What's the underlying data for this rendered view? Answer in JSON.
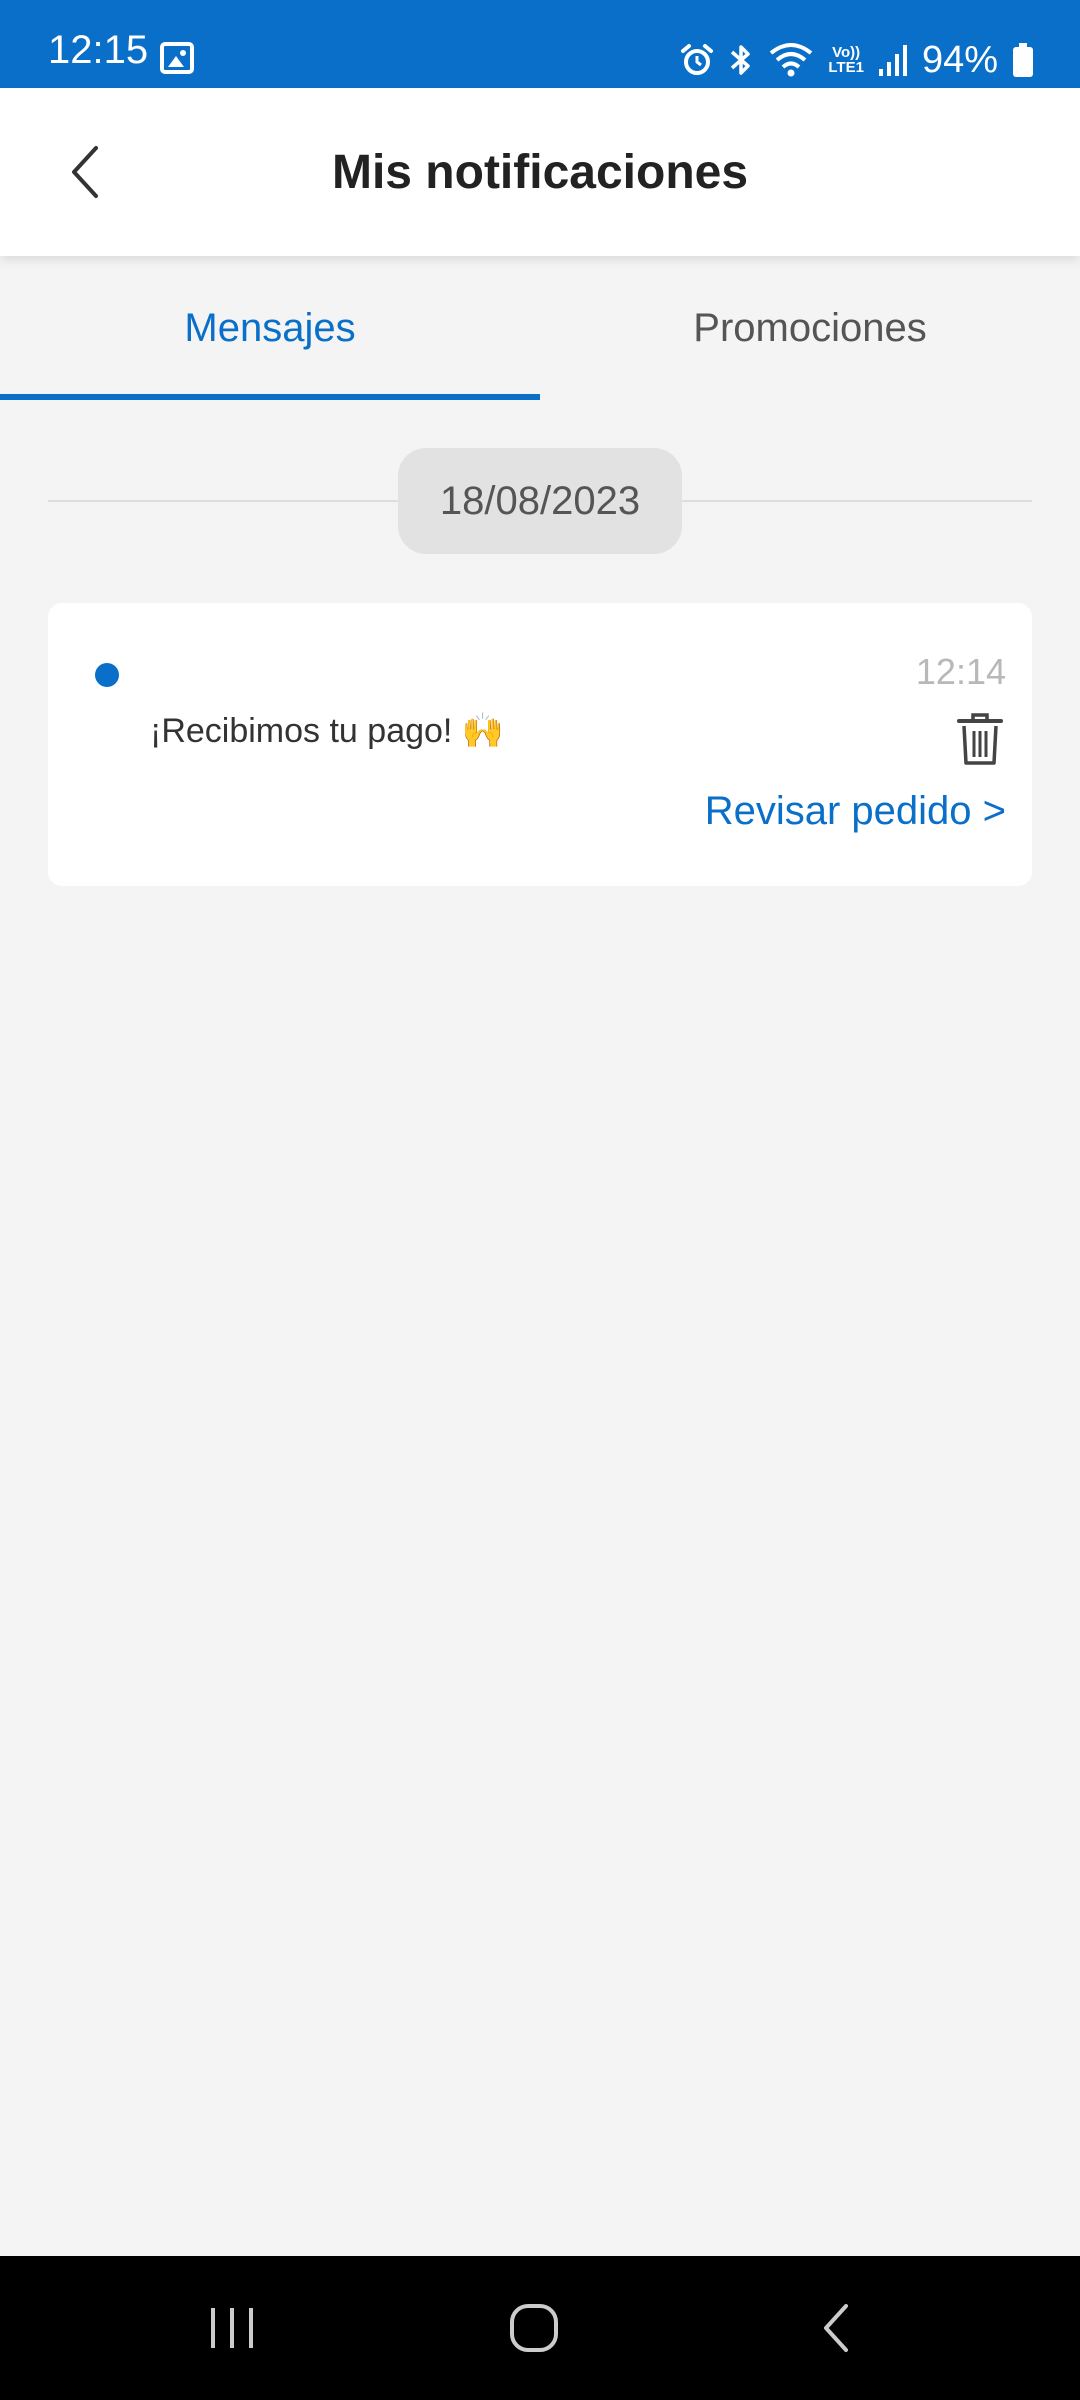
{
  "status_bar": {
    "time": "12:15",
    "battery_percent": "94%",
    "volte_label_top": "Vo))",
    "volte_label_bottom": "LTE1",
    "icons": [
      "gallery-icon",
      "alarm-icon",
      "bluetooth-icon",
      "wifi-icon",
      "volte-icon",
      "signal-icon",
      "battery-icon"
    ]
  },
  "header": {
    "title": "Mis notificaciones",
    "back_icon": "chevron-left-icon"
  },
  "tabs": {
    "messages": "Mensajes",
    "promotions": "Promociones",
    "active": "messages"
  },
  "date_separator": "18/08/2023",
  "notification": {
    "unread": true,
    "time": "12:14",
    "message": "¡Recibimos tu pago! 🙌",
    "action_label": "Revisar pedido >",
    "delete_icon": "trash-icon"
  },
  "nav_bar": {
    "icons": [
      "recent-apps-icon",
      "home-icon",
      "back-icon"
    ]
  },
  "colors": {
    "accent": "#0a6fc9",
    "status_bar": "#0a6fc9",
    "background": "#f4f4f4",
    "card": "#ffffff",
    "nav_bar": "#000000"
  }
}
